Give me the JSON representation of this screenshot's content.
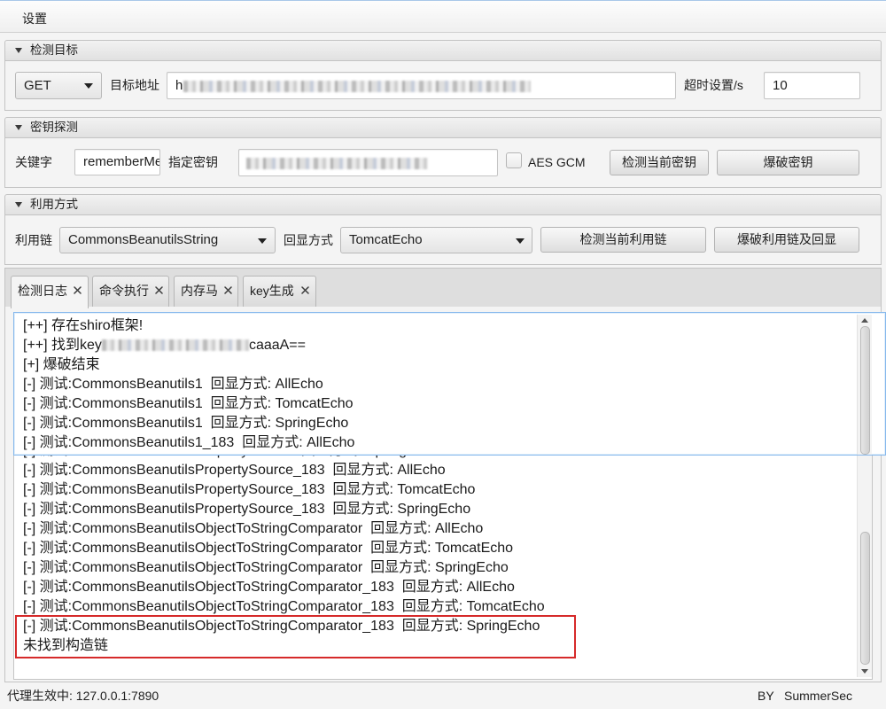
{
  "menu": {
    "settings": "设置"
  },
  "target": {
    "title": "检测目标",
    "method": "GET",
    "url_label": "目标地址",
    "url_visible": "h",
    "timeout_label": "超时设置/s",
    "timeout_value": "10"
  },
  "key_probe": {
    "title": "密钥探测",
    "keyword_label": "关键字",
    "keyword_value": "rememberMe",
    "key_label": "指定密钥",
    "aes_gcm_label": "AES GCM",
    "aes_gcm_checked": false,
    "check_key_button": "检测当前密钥",
    "brute_key_button": "爆破密钥"
  },
  "exploit": {
    "title": "利用方式",
    "chain_label": "利用链",
    "chain_value": "CommonsBeanutilsString",
    "echo_label": "回显方式",
    "echo_value": "TomcatEcho",
    "check_chain_button": "检测当前利用链",
    "brute_chain_button": "爆破利用链及回显"
  },
  "tabs": [
    {
      "label": "检测日志",
      "selected": true
    },
    {
      "label": "命令执行",
      "selected": false
    },
    {
      "label": "内存马",
      "selected": false
    },
    {
      "label": "key生成",
      "selected": false
    }
  ],
  "log": {
    "shiro_found": "[++] 存在shiro框架!",
    "found_key_prefix": "[++] 找到key",
    "found_key_suffix": "caaaA==",
    "overlay_lines": [
      "[+] 爆破结束",
      "[-] 测试:CommonsBeanutils1  回显方式: AllEcho",
      "[-] 测试:CommonsBeanutils1  回显方式: TomcatEcho",
      "[-] 测试:CommonsBeanutils1  回显方式: SpringEcho",
      "[-] 测试:CommonsBeanutils1_183  回显方式: AllEcho"
    ],
    "lines": [
      "[-] 测试:CommonsBeanutilsPropertySource  回显方式: SpringEcho",
      "[-] 测试:CommonsBeanutilsPropertySource_183  回显方式: AllEcho",
      "[-] 测试:CommonsBeanutilsPropertySource_183  回显方式: TomcatEcho",
      "[-] 测试:CommonsBeanutilsPropertySource_183  回显方式: SpringEcho",
      "[-] 测试:CommonsBeanutilsObjectToStringComparator  回显方式: AllEcho",
      "[-] 测试:CommonsBeanutilsObjectToStringComparator  回显方式: TomcatEcho",
      "[-] 测试:CommonsBeanutilsObjectToStringComparator  回显方式: SpringEcho",
      "[-] 测试:CommonsBeanutilsObjectToStringComparator_183  回显方式: AllEcho",
      "[-] 测试:CommonsBeanutilsObjectToStringComparator_183  回显方式: TomcatEcho",
      "[-] 测试:CommonsBeanutilsObjectToStringComparator_183  回显方式: SpringEcho",
      "未找到构造链"
    ]
  },
  "status": {
    "proxy": "代理生效中: 127.0.0.1:7890",
    "by": "BY",
    "author": "SummerSec"
  },
  "icons": {
    "pane_toggle": "triangle-down-icon",
    "combo_toggle": "chevron-down-icon",
    "tab_close": "close-icon"
  },
  "colors": {
    "focus_border": "#86b8ec",
    "annotation_red": "#d62a2a",
    "window_bg": "#f4f4f4"
  }
}
